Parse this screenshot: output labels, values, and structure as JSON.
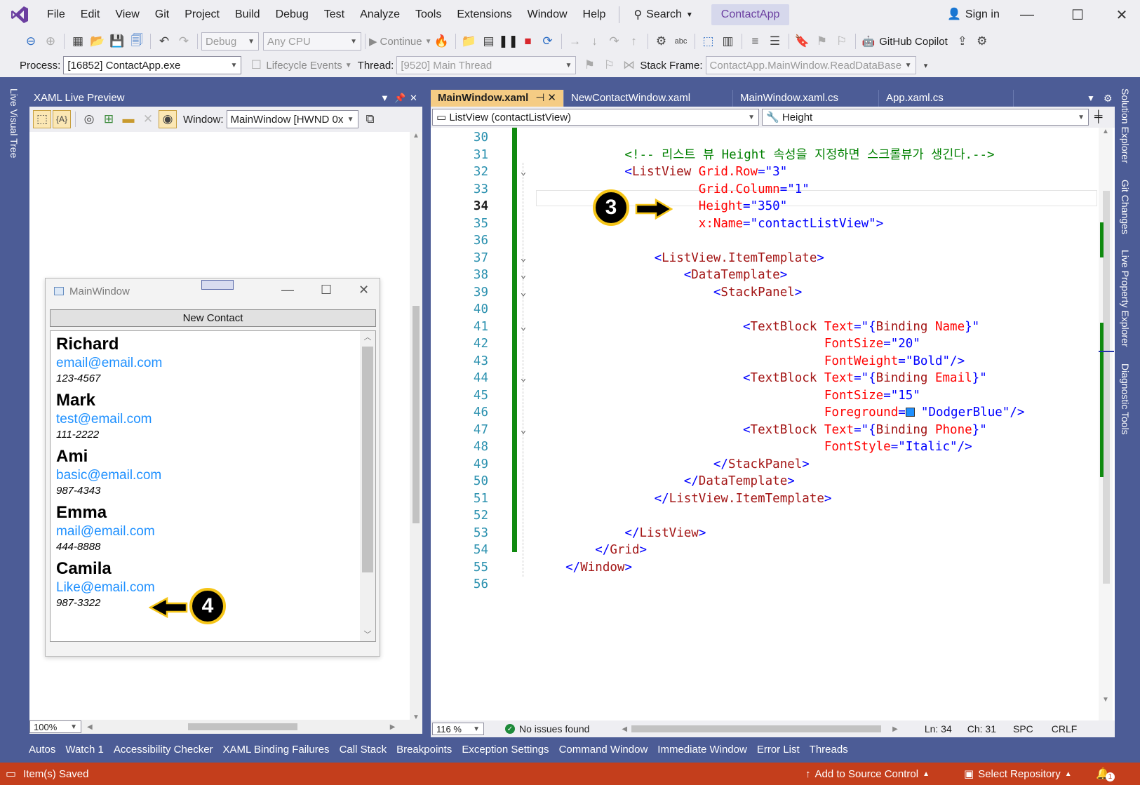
{
  "menu": {
    "items": [
      "File",
      "Edit",
      "View",
      "Git",
      "Project",
      "Build",
      "Debug",
      "Test",
      "Analyze",
      "Tools",
      "Extensions",
      "Window",
      "Help"
    ],
    "search_label": "Search",
    "app_name": "ContactApp",
    "sign_in": "Sign in"
  },
  "toolbar": {
    "config": "Debug",
    "platform": "Any CPU",
    "continue_label": "Continue",
    "copilot_label": "GitHub Copilot",
    "process_label": "Process:",
    "process_value": "[16852] ContactApp.exe",
    "lifecycle_label": "Lifecycle Events",
    "thread_label": "Thread:",
    "thread_value": "[9520] Main Thread",
    "stackframe_label": "Stack Frame:",
    "stackframe_value": "ContactApp.MainWindow.ReadDataBase"
  },
  "side_tabs": {
    "left": "Live Visual Tree",
    "right": [
      "Solution Explorer",
      "Git Changes",
      "Live Property Explorer",
      "Diagnostic Tools"
    ]
  },
  "live_preview": {
    "title": "XAML Live Preview",
    "window_label": "Window:",
    "window_value": "MainWindow [HWND 0x",
    "zoom": "100%",
    "app_window": {
      "title": "MainWindow",
      "button": "New Contact",
      "contacts": [
        {
          "name": "Richard",
          "email": "email@email.com",
          "phone": "123-4567"
        },
        {
          "name": "Mark",
          "email": "test@email.com",
          "phone": "111-2222"
        },
        {
          "name": "Ami",
          "email": "basic@email.com",
          "phone": "987-4343"
        },
        {
          "name": "Emma",
          "email": "mail@email.com",
          "phone": "444-8888"
        },
        {
          "name": "Camila",
          "email": "Like@email.com",
          "phone": "987-3322"
        }
      ]
    }
  },
  "editor": {
    "tabs": [
      "MainWindow.xaml",
      "NewContactWindow.xaml",
      "MainWindow.xaml.cs",
      "App.xaml.cs"
    ],
    "nav_left": "ListView (contactListView)",
    "nav_right": "Height",
    "lines": [
      {
        "n": "30",
        "tokens": []
      },
      {
        "n": "31",
        "tokens": [
          [
            "c-com",
            "            <!-- 리스트 뷰 Height 속성을 지정하면 스크롤뷰가 생긴다.-->"
          ]
        ]
      },
      {
        "n": "32",
        "tokens": [
          [
            "c-br",
            "            <"
          ],
          [
            "c-tag",
            "ListView"
          ],
          [
            "c-attr",
            " Grid.Row"
          ],
          [
            "c-br",
            "="
          ],
          [
            "c-val",
            "\"3\""
          ]
        ]
      },
      {
        "n": "33",
        "tokens": [
          [
            "c-attr",
            "                      Grid.Column"
          ],
          [
            "c-br",
            "="
          ],
          [
            "c-val",
            "\"1\""
          ]
        ]
      },
      {
        "n": "34",
        "tokens": [
          [
            "c-attr",
            "                      Height"
          ],
          [
            "c-br",
            "="
          ],
          [
            "c-val",
            "\"350\""
          ]
        ]
      },
      {
        "n": "35",
        "tokens": [
          [
            "c-attr",
            "                      x:Name"
          ],
          [
            "c-br",
            "="
          ],
          [
            "c-val",
            "\"contactListView\""
          ],
          [
            "c-br",
            ">"
          ]
        ]
      },
      {
        "n": "36",
        "tokens": []
      },
      {
        "n": "37",
        "tokens": [
          [
            "c-br",
            "                <"
          ],
          [
            "c-tag",
            "ListView.ItemTemplate"
          ],
          [
            "c-br",
            ">"
          ]
        ]
      },
      {
        "n": "38",
        "tokens": [
          [
            "c-br",
            "                    <"
          ],
          [
            "c-tag",
            "DataTemplate"
          ],
          [
            "c-br",
            ">"
          ]
        ]
      },
      {
        "n": "39",
        "tokens": [
          [
            "c-br",
            "                        <"
          ],
          [
            "c-tag",
            "StackPanel"
          ],
          [
            "c-br",
            ">"
          ]
        ]
      },
      {
        "n": "40",
        "tokens": []
      },
      {
        "n": "41",
        "tokens": [
          [
            "c-br",
            "                            <"
          ],
          [
            "c-tag",
            "TextBlock"
          ],
          [
            "c-attr",
            " Text"
          ],
          [
            "c-br",
            "=\"{"
          ],
          [
            "c-tag",
            "Binding"
          ],
          [
            "c-attr",
            " Name"
          ],
          [
            "c-br",
            "}\""
          ]
        ]
      },
      {
        "n": "42",
        "tokens": [
          [
            "c-attr",
            "                                       FontSize"
          ],
          [
            "c-br",
            "="
          ],
          [
            "c-val",
            "\"20\""
          ]
        ]
      },
      {
        "n": "43",
        "tokens": [
          [
            "c-attr",
            "                                       FontWeight"
          ],
          [
            "c-br",
            "="
          ],
          [
            "c-val",
            "\"Bold\""
          ],
          [
            "c-br",
            "/>"
          ]
        ]
      },
      {
        "n": "44",
        "tokens": [
          [
            "c-br",
            "                            <"
          ],
          [
            "c-tag",
            "TextBlock"
          ],
          [
            "c-attr",
            " Text"
          ],
          [
            "c-br",
            "=\"{"
          ],
          [
            "c-tag",
            "Binding"
          ],
          [
            "c-attr",
            " Email"
          ],
          [
            "c-br",
            "}\""
          ]
        ]
      },
      {
        "n": "45",
        "tokens": [
          [
            "c-attr",
            "                                       FontSize"
          ],
          [
            "c-br",
            "="
          ],
          [
            "c-val",
            "\"15\""
          ]
        ]
      },
      {
        "n": "46",
        "tokens": [
          [
            "c-attr",
            "                                       Foreground"
          ],
          [
            "c-br",
            "="
          ],
          [
            "c-val",
            "  \"DodgerBlue\""
          ],
          [
            "c-br",
            "/>"
          ]
        ]
      },
      {
        "n": "47",
        "tokens": [
          [
            "c-br",
            "                            <"
          ],
          [
            "c-tag",
            "TextBlock"
          ],
          [
            "c-attr",
            " Text"
          ],
          [
            "c-br",
            "=\"{"
          ],
          [
            "c-tag",
            "Binding"
          ],
          [
            "c-attr",
            " Phone"
          ],
          [
            "c-br",
            "}\""
          ]
        ]
      },
      {
        "n": "48",
        "tokens": [
          [
            "c-attr",
            "                                       FontStyle"
          ],
          [
            "c-br",
            "="
          ],
          [
            "c-val",
            "\"Italic\""
          ],
          [
            "c-br",
            "/>"
          ]
        ]
      },
      {
        "n": "49",
        "tokens": [
          [
            "c-br",
            "                        </"
          ],
          [
            "c-tag",
            "StackPanel"
          ],
          [
            "c-br",
            ">"
          ]
        ]
      },
      {
        "n": "50",
        "tokens": [
          [
            "c-br",
            "                    </"
          ],
          [
            "c-tag",
            "DataTemplate"
          ],
          [
            "c-br",
            ">"
          ]
        ]
      },
      {
        "n": "51",
        "tokens": [
          [
            "c-br",
            "                </"
          ],
          [
            "c-tag",
            "ListView.ItemTemplate"
          ],
          [
            "c-br",
            ">"
          ]
        ]
      },
      {
        "n": "52",
        "tokens": []
      },
      {
        "n": "53",
        "tokens": [
          [
            "c-br",
            "            </"
          ],
          [
            "c-tag",
            "ListView"
          ],
          [
            "c-br",
            ">"
          ]
        ]
      },
      {
        "n": "54",
        "tokens": [
          [
            "c-br",
            "        </"
          ],
          [
            "c-tag",
            "Grid"
          ],
          [
            "c-br",
            ">"
          ]
        ]
      },
      {
        "n": "55",
        "tokens": [
          [
            "c-br",
            "    </"
          ],
          [
            "c-tag",
            "Window"
          ],
          [
            "c-br",
            ">"
          ]
        ]
      },
      {
        "n": "56",
        "tokens": []
      }
    ],
    "current_line": "34",
    "dodgerblue": "#1E90FF"
  },
  "editor_status": {
    "zoom": "116 %",
    "issues": "No issues found",
    "ln": "Ln: 34",
    "ch": "Ch: 31",
    "spc": "SPC",
    "crlf": "CRLF"
  },
  "tool_tabs": [
    "Autos",
    "Watch 1",
    "Accessibility Checker",
    "XAML Binding Failures",
    "Call Stack",
    "Breakpoints",
    "Exception Settings",
    "Command Window",
    "Immediate Window",
    "Error List",
    "Threads"
  ],
  "status": {
    "message": "Item(s) Saved",
    "add_source": "Add to Source Control",
    "select_repo": "Select Repository",
    "notification_count": "1"
  },
  "callouts": [
    "3",
    "4"
  ],
  "colors": {
    "accent_purple": "#6B3FA0",
    "frame_blue": "#4C5C96",
    "status_orange": "#C43E1C",
    "active_tab": "#F5CC84",
    "callout_yellow": "#F5C518"
  }
}
